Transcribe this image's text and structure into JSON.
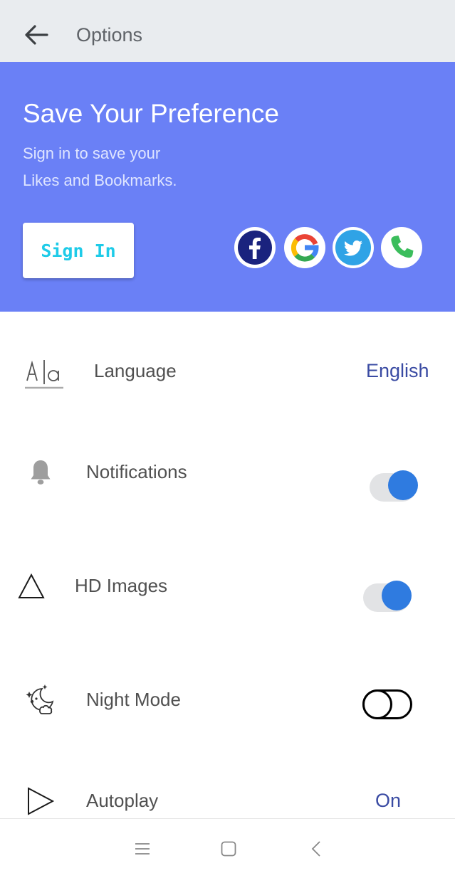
{
  "topbar": {
    "title": "Options",
    "back_icon": "arrow-left-icon"
  },
  "banner": {
    "title": "Save Your Preference",
    "subtitle_line1": "Sign in to save your",
    "subtitle_line2": "Likes and Bookmarks.",
    "signin_label": "Sign In",
    "background": "#6a80f6",
    "social_icons": [
      "facebook-icon",
      "google-icon",
      "twitter-icon",
      "phone-icon"
    ]
  },
  "settings": {
    "language": {
      "label": "Language",
      "value": "English",
      "icon": "language-icon"
    },
    "notifications": {
      "label": "Notifications",
      "enabled": true,
      "icon": "bell-icon"
    },
    "hd_images": {
      "label": "HD Images",
      "enabled": true,
      "icon": "triangle-icon"
    },
    "night_mode": {
      "label": "Night Mode",
      "enabled": false,
      "icon": "moon-icon"
    },
    "autoplay": {
      "label": "Autoplay",
      "value": "On",
      "icon": "play-icon"
    }
  },
  "colors": {
    "accent": "#2f7be0",
    "link": "#3a4ba3",
    "signin_text": "#1ecbe8"
  },
  "navbar": {
    "icons": [
      "menu-icon",
      "home-square-icon",
      "back-chevron-icon"
    ]
  }
}
